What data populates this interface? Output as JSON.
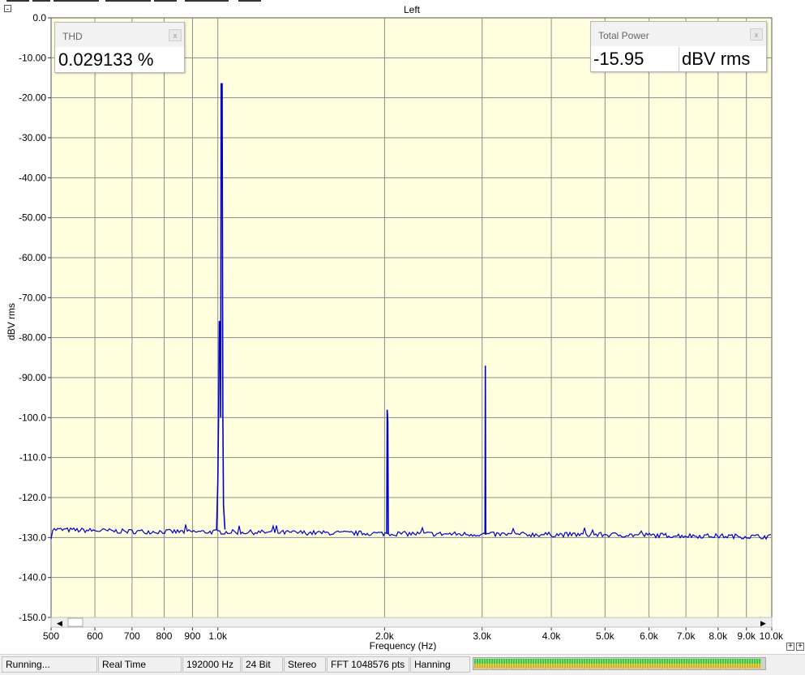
{
  "window": {
    "collapse_glyph": "-",
    "zoom_plus_glyph": "+"
  },
  "thd_panel": {
    "title": "THD",
    "value": "0.029133 %",
    "close_glyph": "x"
  },
  "power_panel": {
    "title": "Total Power",
    "value": "-15.95",
    "unit": "dBV rms",
    "close_glyph": "x"
  },
  "status": {
    "running": "Running...",
    "mode": "Real Time",
    "sample_rate": "192000 Hz",
    "bit_depth": "24 Bit",
    "channels": "Stereo",
    "fft": "FFT 1048576 pts",
    "window_fn": "Hanning",
    "level_fraction": 0.99
  },
  "colors": {
    "plot_bg": "#ffffe0",
    "grid": "#8c8c8c",
    "trace": "#0000c8"
  },
  "chart_data": {
    "type": "line",
    "title": "Left",
    "xlabel": "Frequency (Hz)",
    "ylabel": "dBV rms",
    "x_scale": "log",
    "xlim": [
      500,
      10000
    ],
    "ylim": [
      -150,
      0
    ],
    "x_ticks": [
      {
        "v": 500,
        "label": "500"
      },
      {
        "v": 600,
        "label": "600"
      },
      {
        "v": 700,
        "label": "700"
      },
      {
        "v": 800,
        "label": "800"
      },
      {
        "v": 900,
        "label": "900"
      },
      {
        "v": 1000,
        "label": "1.0k"
      },
      {
        "v": 2000,
        "label": "2.0k"
      },
      {
        "v": 3000,
        "label": "3.0k"
      },
      {
        "v": 4000,
        "label": "4.0k"
      },
      {
        "v": 5000,
        "label": "5.0k"
      },
      {
        "v": 6000,
        "label": "6.0k"
      },
      {
        "v": 7000,
        "label": "7.0k"
      },
      {
        "v": 8000,
        "label": "8.0k"
      },
      {
        "v": 9000,
        "label": "9.0k"
      },
      {
        "v": 10000,
        "label": "10.0k"
      }
    ],
    "y_ticks": [
      {
        "v": 0,
        "label": "0.0"
      },
      {
        "v": -10,
        "label": "-10.00"
      },
      {
        "v": -20,
        "label": "-20.00"
      },
      {
        "v": -30,
        "label": "-30.00"
      },
      {
        "v": -40,
        "label": "-40.00"
      },
      {
        "v": -50,
        "label": "-50.00"
      },
      {
        "v": -60,
        "label": "-60.00"
      },
      {
        "v": -70,
        "label": "-70.00"
      },
      {
        "v": -80,
        "label": "-80.00"
      },
      {
        "v": -90,
        "label": "-90.00"
      },
      {
        "v": -100,
        "label": "-100.0"
      },
      {
        "v": -110,
        "label": "-110.0"
      },
      {
        "v": -120,
        "label": "-120.0"
      },
      {
        "v": -130,
        "label": "-130.0"
      },
      {
        "v": -140,
        "label": "-140.0"
      },
      {
        "v": -150,
        "label": "-150.0"
      }
    ],
    "grid": true,
    "series": [
      {
        "noise_floor": [
          [
            500,
            -128.0
          ],
          [
            700,
            -128.5
          ],
          [
            1000,
            -128.6
          ],
          [
            2000,
            -129.0
          ],
          [
            3000,
            -129.2
          ],
          [
            5000,
            -129.3
          ],
          [
            10000,
            -129.8
          ]
        ],
        "peaks": [
          {
            "points": [
              [
                995,
                -128
              ],
              [
                1000,
                -116
              ],
              [
                1003,
                -100
              ],
              [
                1006,
                -76
              ],
              [
                1009,
                -76
              ],
              [
                1012,
                -100
              ],
              [
                1014,
                -16.5
              ],
              [
                1018,
                -16.5
              ],
              [
                1021,
                -100
              ],
              [
                1024,
                -122
              ],
              [
                1030,
                -128
              ]
            ]
          },
          {
            "points": [
              [
                2018,
                -129
              ],
              [
                2022,
                -98
              ],
              [
                2027,
                -101
              ],
              [
                2031,
                -129
              ]
            ]
          },
          {
            "points": [
              [
                3036,
                -129
              ],
              [
                3041,
                -87
              ],
              [
                3046,
                -129
              ]
            ]
          }
        ]
      }
    ]
  }
}
